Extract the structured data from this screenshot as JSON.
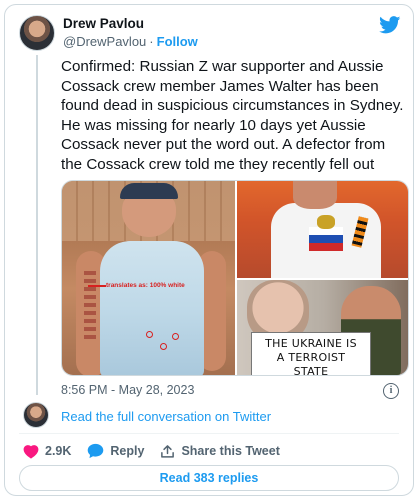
{
  "author": {
    "name": "Drew Pavlou",
    "handle": "@DrewPavlou",
    "separator": "·",
    "follow_label": "Follow"
  },
  "tweet": {
    "text": "Confirmed: Russian Z war supporter and Aussie Cossack crew member James Walter has been found dead in suspicious circumstances in Sydney. He was missing for nearly 10 days yet Aussie Cossack never put the word out. A defector from the Cossack crew told me they recently fell out",
    "timestamp": "8:56 PM - May 28, 2023"
  },
  "media": {
    "left_annotation": "translates as: 100% white",
    "sign_text": "THE UKRAINE IS\nA TERROIST STATE\nSUPPORT"
  },
  "thread": {
    "read_full_label": "Read the full conversation on Twitter"
  },
  "actions": {
    "like_count": "2.9K",
    "reply_label": "Reply",
    "share_label": "Share this Tweet",
    "read_replies_label": "Read 383 replies"
  },
  "colors": {
    "accent": "#1d9bf0",
    "like": "#f91880",
    "text": "#0f1419",
    "muted": "#536471",
    "border": "#cfd9de"
  },
  "icons": [
    "twitter-bird-icon",
    "info-icon",
    "heart-icon",
    "reply-bubble-icon",
    "share-icon"
  ]
}
